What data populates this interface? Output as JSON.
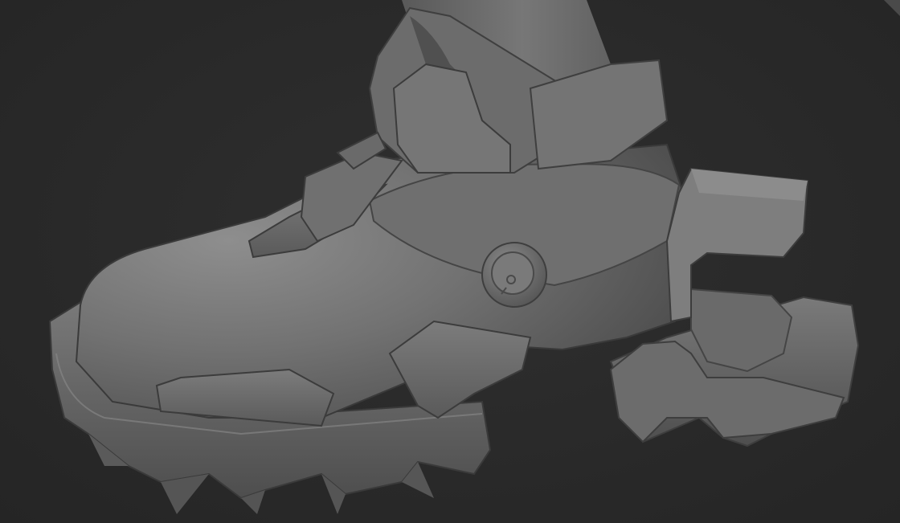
{
  "scene": {
    "subject_icon": "boot-sculpt",
    "colors": {
      "background": "#2a2a2a",
      "clay_base": "#6e6e6e",
      "clay_light": "#8c8c8c",
      "clay_dark": "#4a4a4a",
      "clay_edge": "#3a3a3a"
    }
  }
}
